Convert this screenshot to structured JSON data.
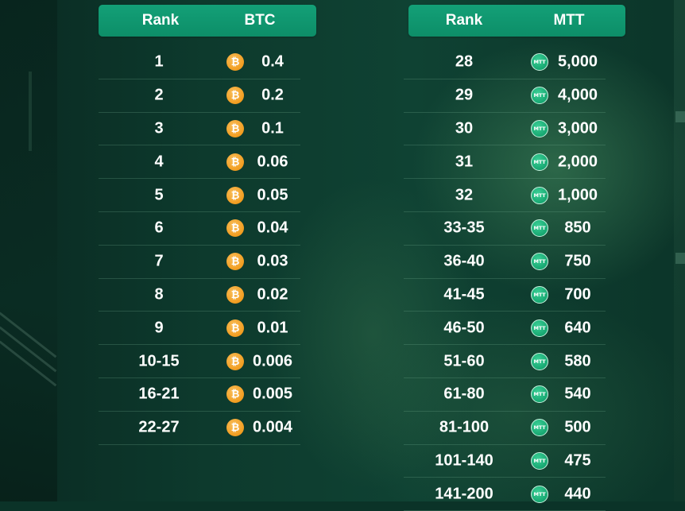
{
  "btc_table": {
    "headers": {
      "rank": "Rank",
      "prize": "BTC"
    },
    "coin_glyph": "₿",
    "rows": [
      {
        "rank": "1",
        "amount": "0.4"
      },
      {
        "rank": "2",
        "amount": "0.2"
      },
      {
        "rank": "3",
        "amount": "0.1"
      },
      {
        "rank": "4",
        "amount": "0.06"
      },
      {
        "rank": "5",
        "amount": "0.05"
      },
      {
        "rank": "6",
        "amount": "0.04"
      },
      {
        "rank": "7",
        "amount": "0.03"
      },
      {
        "rank": "8",
        "amount": "0.02"
      },
      {
        "rank": "9",
        "amount": "0.01"
      },
      {
        "rank": "10-15",
        "amount": "0.006"
      },
      {
        "rank": "16-21",
        "amount": "0.005"
      },
      {
        "rank": "22-27",
        "amount": "0.004"
      }
    ]
  },
  "mtt_table": {
    "headers": {
      "rank": "Rank",
      "prize": "MTT"
    },
    "coin_glyph": "MTT",
    "rows": [
      {
        "rank": "28",
        "amount": "5,000"
      },
      {
        "rank": "29",
        "amount": "4,000"
      },
      {
        "rank": "30",
        "amount": "3,000"
      },
      {
        "rank": "31",
        "amount": "2,000"
      },
      {
        "rank": "32",
        "amount": "1,000"
      },
      {
        "rank": "33-35",
        "amount": "850"
      },
      {
        "rank": "36-40",
        "amount": "750"
      },
      {
        "rank": "41-45",
        "amount": "700"
      },
      {
        "rank": "46-50",
        "amount": "640"
      },
      {
        "rank": "51-60",
        "amount": "580"
      },
      {
        "rank": "61-80",
        "amount": "540"
      },
      {
        "rank": "81-100",
        "amount": "500"
      },
      {
        "rank": "101-140",
        "amount": "475"
      },
      {
        "rank": "141-200",
        "amount": "440"
      }
    ]
  },
  "icons": {
    "btc": "bitcoin-coin-icon",
    "mtt": "mtt-coin-icon"
  },
  "colors": {
    "header_bg": "#0f9a70",
    "btc_coin": "#f29d20",
    "mtt_coin": "#17a872",
    "background": "#0b3328"
  }
}
